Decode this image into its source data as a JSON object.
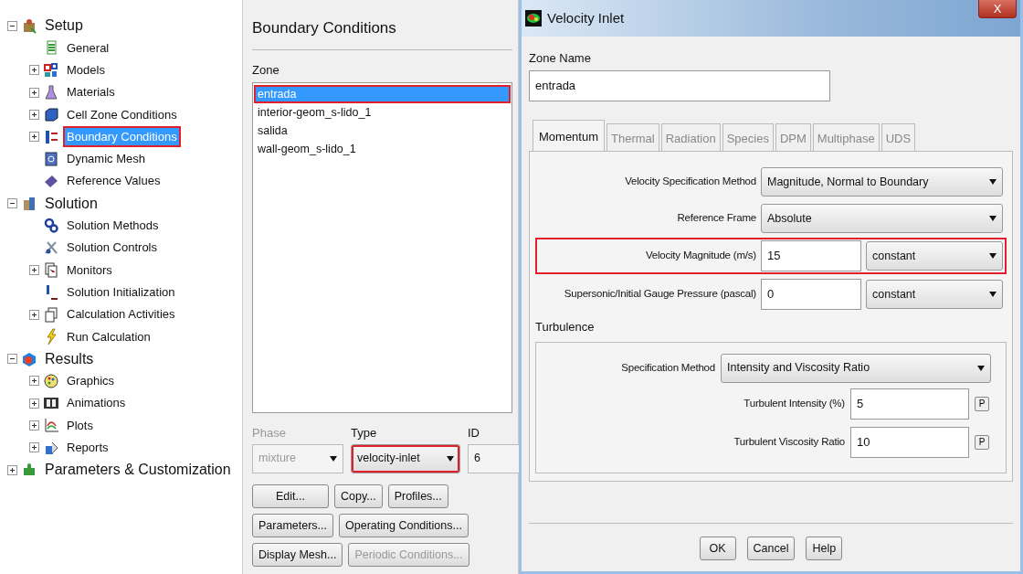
{
  "tree": [
    {
      "label": "Setup",
      "expanded": true,
      "selected": false,
      "highlighted": false,
      "children": [
        {
          "label": "General",
          "expandable": false,
          "selected": false,
          "highlighted": false
        },
        {
          "label": "Models",
          "expandable": true,
          "selected": false,
          "highlighted": false
        },
        {
          "label": "Materials",
          "expandable": true,
          "selected": false,
          "highlighted": false
        },
        {
          "label": "Cell Zone Conditions",
          "expandable": true,
          "selected": false,
          "highlighted": false
        },
        {
          "label": "Boundary Conditions",
          "expandable": true,
          "selected": true,
          "highlighted": true
        },
        {
          "label": "Dynamic Mesh",
          "expandable": false,
          "selected": false,
          "highlighted": false
        },
        {
          "label": "Reference Values",
          "expandable": false,
          "selected": false,
          "highlighted": false
        }
      ]
    },
    {
      "label": "Solution",
      "expanded": true,
      "selected": false,
      "highlighted": false,
      "children": [
        {
          "label": "Solution Methods",
          "expandable": false,
          "selected": false,
          "highlighted": false
        },
        {
          "label": "Solution Controls",
          "expandable": false,
          "selected": false,
          "highlighted": false
        },
        {
          "label": "Monitors",
          "expandable": true,
          "selected": false,
          "highlighted": false
        },
        {
          "label": "Solution Initialization",
          "expandable": false,
          "selected": false,
          "highlighted": false
        },
        {
          "label": "Calculation Activities",
          "expandable": true,
          "selected": false,
          "highlighted": false
        },
        {
          "label": "Run Calculation",
          "expandable": false,
          "selected": false,
          "highlighted": false
        }
      ]
    },
    {
      "label": "Results",
      "expanded": true,
      "selected": false,
      "highlighted": false,
      "children": [
        {
          "label": "Graphics",
          "expandable": true,
          "selected": false,
          "highlighted": false
        },
        {
          "label": "Animations",
          "expandable": true,
          "selected": false,
          "highlighted": false
        },
        {
          "label": "Plots",
          "expandable": true,
          "selected": false,
          "highlighted": false
        },
        {
          "label": "Reports",
          "expandable": true,
          "selected": false,
          "highlighted": false
        }
      ]
    },
    {
      "label": "Parameters & Customization",
      "expanded": false,
      "selected": false,
      "highlighted": false
    }
  ],
  "boundary_panel": {
    "title": "Boundary Conditions",
    "zone_label": "Zone",
    "zones": [
      {
        "label": "entrada",
        "selected": true,
        "highlighted": true
      },
      {
        "label": "interior-geom_s-lido_1",
        "selected": false,
        "highlighted": false
      },
      {
        "label": "salida",
        "selected": false,
        "highlighted": false
      },
      {
        "label": "wall-geom_s-lido_1",
        "selected": false,
        "highlighted": false
      }
    ],
    "phase": {
      "label": "Phase",
      "value": "mixture",
      "disabled": true
    },
    "type": {
      "label": "Type",
      "value": "velocity-inlet",
      "highlighted": true
    },
    "id": {
      "label": "ID",
      "value": "6"
    },
    "buttons": [
      [
        {
          "label": "Edit...",
          "disabled": false
        },
        {
          "label": "Copy...",
          "disabled": false
        },
        {
          "label": "Profiles...",
          "disabled": false
        }
      ],
      [
        {
          "label": "Parameters...",
          "disabled": false
        },
        {
          "label": "Operating Conditions...",
          "disabled": false
        }
      ],
      [
        {
          "label": "Display Mesh...",
          "disabled": false
        },
        {
          "label": "Periodic Conditions...",
          "disabled": true
        }
      ]
    ]
  },
  "dialog": {
    "title": "Velocity Inlet",
    "close": "X",
    "zone_name_label": "Zone Name",
    "zone_name": "entrada",
    "tabs": [
      {
        "label": "Momentum",
        "selected": true
      },
      {
        "label": "Thermal",
        "selected": false
      },
      {
        "label": "Radiation",
        "selected": false
      },
      {
        "label": "Species",
        "selected": false
      },
      {
        "label": "DPM",
        "selected": false
      },
      {
        "label": "Multiphase",
        "selected": false
      },
      {
        "label": "UDS",
        "selected": false
      }
    ],
    "rows": [
      {
        "kind": "select",
        "label": "Velocity Specification Method",
        "value": "Magnitude, Normal to Boundary",
        "highlighted": false
      },
      {
        "kind": "select",
        "label": "Reference Frame",
        "value": "Absolute",
        "highlighted": false
      },
      {
        "kind": "value",
        "label": "Velocity Magnitude (m/s)",
        "value": "15",
        "method": "constant",
        "highlighted": true
      },
      {
        "kind": "value",
        "label": "Supersonic/Initial Gauge Pressure (pascal)",
        "value": "0",
        "method": "constant",
        "highlighted": false
      }
    ],
    "turbulence": {
      "title": "Turbulence",
      "rows": [
        {
          "kind": "select",
          "label": "Specification Method",
          "value": "Intensity and Viscosity Ratio"
        },
        {
          "kind": "param",
          "label": "Turbulent Intensity (%)",
          "value": "5",
          "button": "P"
        },
        {
          "kind": "param",
          "label": "Turbulent Viscosity Ratio",
          "value": "10",
          "button": "P"
        }
      ]
    },
    "buttons": [
      "OK",
      "Cancel",
      "Help"
    ]
  }
}
